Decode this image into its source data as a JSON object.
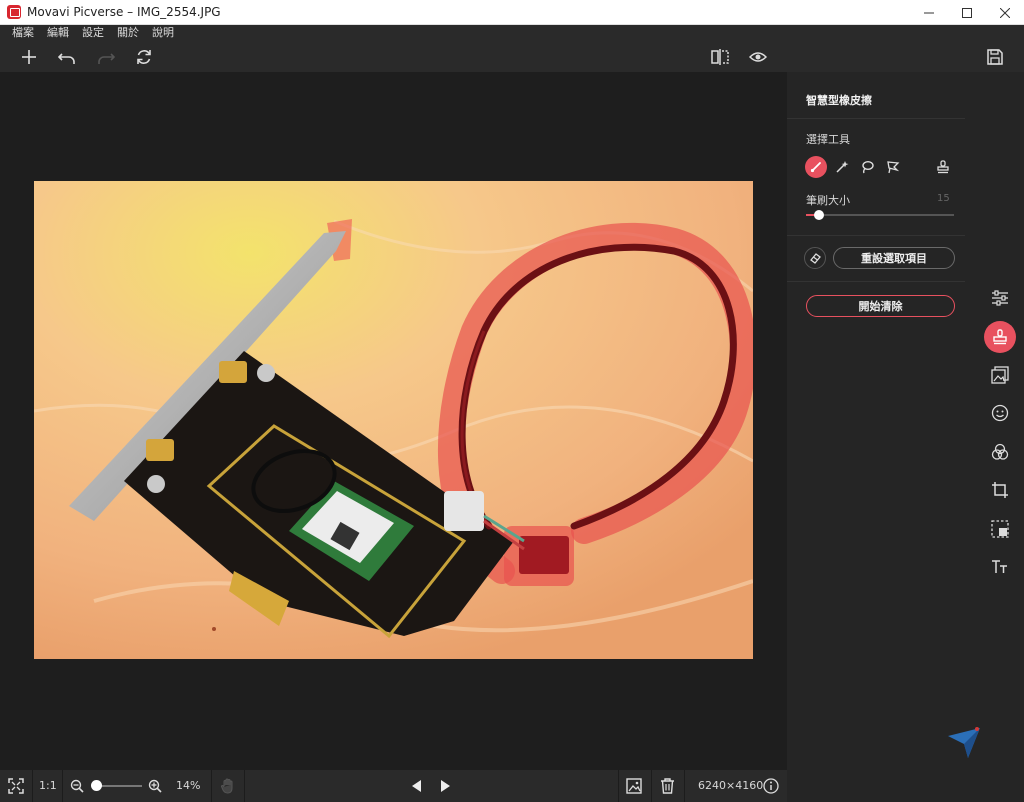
{
  "window": {
    "title": "Movavi Picverse – IMG_2554.JPG",
    "controls": [
      "minimize",
      "maximize",
      "close"
    ]
  },
  "menu": {
    "items": [
      "檔案",
      "編輯",
      "設定",
      "關於",
      "說明"
    ]
  },
  "toolbar": {
    "icons": [
      "add-icon",
      "undo-icon",
      "redo-icon",
      "refresh-icon",
      "compare-icon",
      "preview-eye-icon",
      "save-icon"
    ]
  },
  "panel": {
    "title": "智慧型橡皮擦",
    "select_tool_label": "選擇工具",
    "tools": [
      "brush-icon",
      "magic-wand-icon",
      "lasso-icon",
      "polygon-lasso-icon",
      "stamp-icon"
    ],
    "active_tool": "brush-icon",
    "brush_size_label": "筆刷大小",
    "brush_size_value": "15",
    "reset_selection_label": "重設選取項目",
    "start_erase_label": "開始清除"
  },
  "side_rail": {
    "icons": [
      "adjust-sliders-icon",
      "eraser-stamp-icon",
      "background-replace-icon",
      "retouch-face-icon",
      "effects-icon",
      "crop-icon",
      "select-area-icon",
      "text-icon"
    ],
    "active": "eraser-stamp-icon"
  },
  "statusbar": {
    "fit_icon": "fit-screen-icon",
    "ratio_label": "1:1",
    "zoom_percent": "14%",
    "dimensions": "6240×4160",
    "zoom_slider_fraction": 0.02
  },
  "colors": {
    "accent": "#e8515f",
    "panel_bg": "#252525",
    "bar_bg": "#2a2a2a",
    "canvas_bg": "#1e1e1e"
  }
}
